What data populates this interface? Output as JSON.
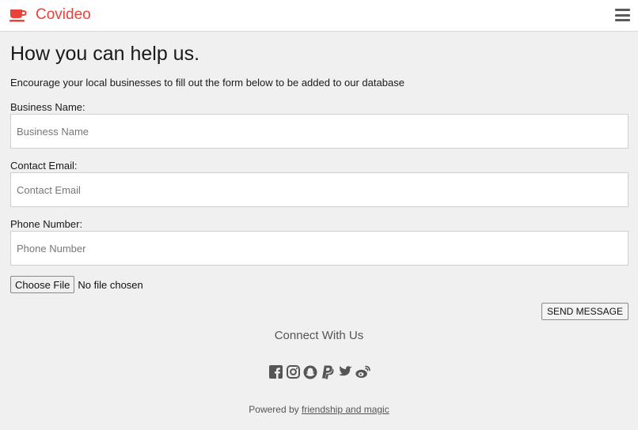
{
  "colors": {
    "brand": "#e8423a",
    "background": "#f0f0f0",
    "icon_gray": "#555555"
  },
  "navbar": {
    "brand_icon": "coffee-cup-icon",
    "brand_name": "Covideo",
    "menu_icon": "hamburger-menu-icon"
  },
  "main": {
    "title": "How you can help us.",
    "intro": "Encourage your local businesses to fill out the form below to be added to our database"
  },
  "form": {
    "business_name": {
      "label": "Business Name:",
      "placeholder": "Business Name",
      "value": ""
    },
    "contact_email": {
      "label": "Contact Email:",
      "placeholder": "Contact Email",
      "value": ""
    },
    "phone_number": {
      "label": "Phone Number:",
      "placeholder": "Phone Number",
      "value": ""
    },
    "file": {
      "button_label": "Choose File",
      "status": "No file chosen"
    },
    "send_label": "SEND MESSAGE"
  },
  "connect": {
    "title": "Connect With Us",
    "icons": [
      "facebook-icon",
      "instagram-icon",
      "snapchat-icon",
      "paypal-icon",
      "twitter-icon",
      "weibo-icon"
    ]
  },
  "footer": {
    "prefix": "Powered by ",
    "link_text": "friendship and magic"
  }
}
